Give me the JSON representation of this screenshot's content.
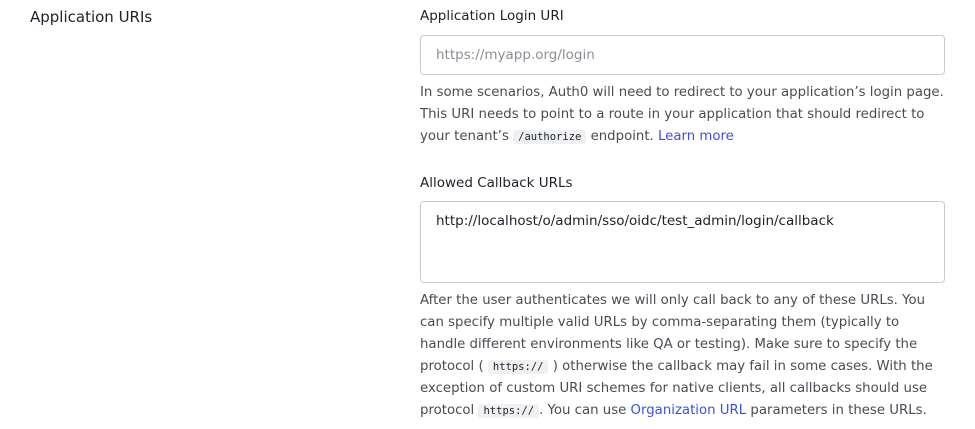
{
  "section": {
    "title": "Application URIs"
  },
  "login_uri": {
    "label": "Application Login URI",
    "value": "",
    "placeholder": "https://myapp.org/login",
    "help": {
      "part1": "In some scenarios, Auth0 will need to redirect to your application’s login page. This URI needs to point to a route in your application that should redirect to your tenant’s",
      "code": "/authorize",
      "part2": "endpoint.",
      "link": "Learn more"
    }
  },
  "callback_urls": {
    "label": "Allowed Callback URLs",
    "value": "http://localhost/o/admin/sso/oidc/test_admin/login/callback",
    "help": {
      "part1": "After the user authenticates we will only call back to any of these URLs. You can specify multiple valid URLs by comma-separating them (typically to handle different environments like QA or testing). Make sure to specify the protocol (",
      "code1": "https://",
      "part2": ") otherwise the callback may fail in some cases. With the exception of custom URI schemes for native clients, all callbacks should use protocol",
      "code2": "https://",
      "part3": ". You can use",
      "link": "Organization URL",
      "part4": "parameters in these URLs."
    }
  }
}
